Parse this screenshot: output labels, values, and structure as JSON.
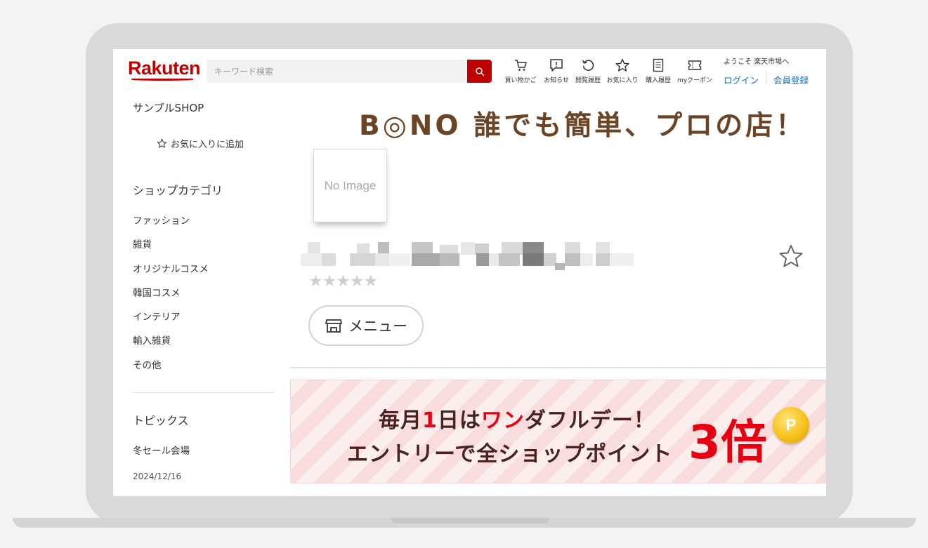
{
  "header": {
    "logo": "Rakuten",
    "search_placeholder": "キーワード検索",
    "nav": [
      {
        "icon": "cart-icon",
        "label": "買い物かご"
      },
      {
        "icon": "notification-icon",
        "label": "お知らせ"
      },
      {
        "icon": "history-icon",
        "label": "閲覧履歴"
      },
      {
        "icon": "star-icon",
        "label": "お気に入り"
      },
      {
        "icon": "purchase-history-icon",
        "label": "購入履歴"
      },
      {
        "icon": "coupon-icon",
        "label": "myクーポン"
      }
    ],
    "welcome": "ようこそ 楽天市場へ",
    "login": "ログイン",
    "register": "会員登録"
  },
  "sidebar": {
    "shop_name": "サンプルSHOP",
    "favorite_add": "お気に入りに追加",
    "category_title": "ショップカテゴリ",
    "categories": [
      "ファッション",
      "雑貨",
      "オリジナルコスメ",
      "韓国コスメ",
      "インテリア",
      "輸入雑貨",
      "その他"
    ],
    "topics_title": "トピックス",
    "topic_item": "冬セール会場",
    "topic_date": "2024/12/16"
  },
  "main": {
    "banner_text": "B◎NO 誰でも簡単、プロの店！",
    "no_image": "No Image",
    "rating_stars": "★★★★★",
    "menu_button": "メニュー",
    "promo": {
      "line1_pre": "毎月",
      "line1_red": "1",
      "line1_mid": "日は",
      "line1_red2": "ワン",
      "line1_post": "ダフルデー！",
      "line2": "エントリーで全ショップポイント",
      "multiplier": "3倍",
      "coin_letter": "P"
    }
  },
  "colors": {
    "brand_red": "#bf0000",
    "link_blue": "#0c6dc4",
    "banner_brown": "#6b4426",
    "promo_red": "#e60012"
  }
}
